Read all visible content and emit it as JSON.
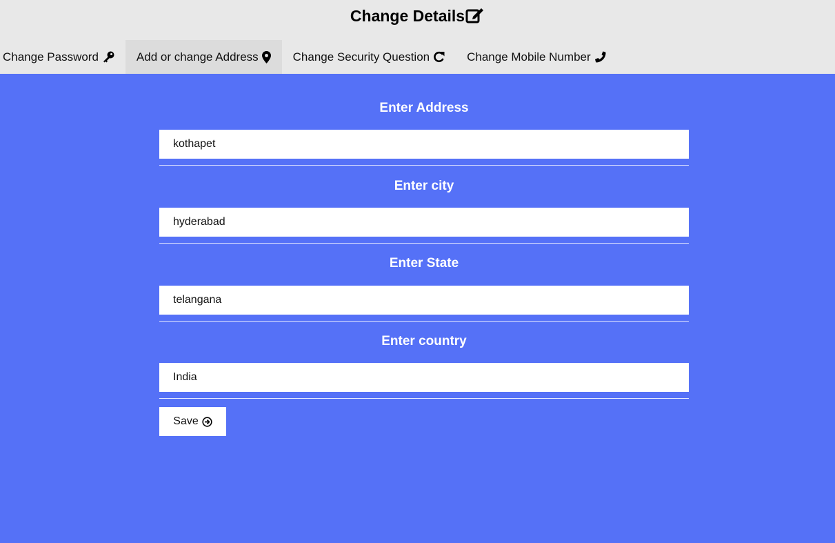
{
  "header": {
    "title": "Change Details",
    "title_icon": "edit-icon"
  },
  "tabs": [
    {
      "label": "Change Password",
      "icon": "key-icon",
      "active": false
    },
    {
      "label": "Add or change Address",
      "icon": "map-marker-icon",
      "active": true
    },
    {
      "label": "Change Security Question",
      "icon": "redo-icon",
      "active": false
    },
    {
      "label": "Change Mobile Number",
      "icon": "phone-icon",
      "active": false
    }
  ],
  "form": {
    "fields": [
      {
        "label": "Enter Address",
        "value": "kothapet"
      },
      {
        "label": "Enter city",
        "value": "hyderabad"
      },
      {
        "label": "Enter State",
        "value": "telangana"
      },
      {
        "label": "Enter country",
        "value": "India"
      }
    ],
    "save_label": "Save",
    "save_icon": "arrow-circle-right-icon"
  },
  "colors": {
    "header_bg": "#e8e8e8",
    "active_tab_bg": "#dcdcdc",
    "main_bg": "#5571f7",
    "label_color": "#ffffff"
  }
}
